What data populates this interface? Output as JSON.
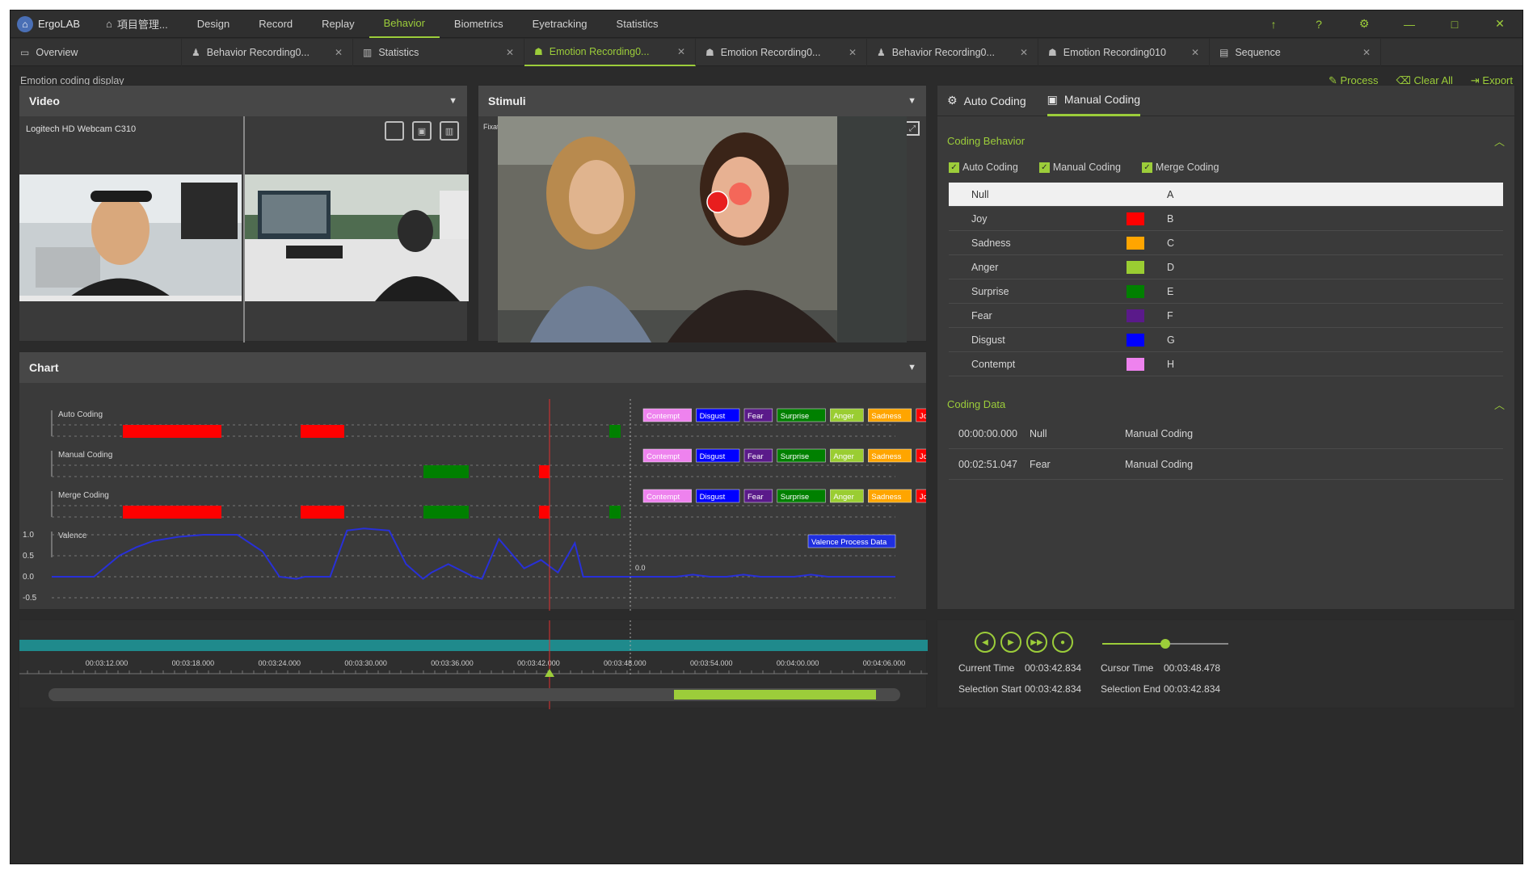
{
  "menubar": {
    "app": "ErgoLAB",
    "items": [
      "項目管理...",
      "Design",
      "Record",
      "Replay",
      "Behavior",
      "Biometrics",
      "Eyetracking",
      "Statistics"
    ],
    "active_index": 4,
    "controls": [
      "↑",
      "?",
      "⚙",
      "—",
      "□",
      "✕"
    ]
  },
  "tabs": [
    {
      "icon": "▭",
      "label": "Overview",
      "closable": false
    },
    {
      "icon": "♟",
      "label": "Behavior Recording0...",
      "closable": true
    },
    {
      "icon": "▥",
      "label": "Statistics",
      "closable": true
    },
    {
      "icon": "☗",
      "label": "Emotion Recording0...",
      "closable": true,
      "active": true
    },
    {
      "icon": "☗",
      "label": "Emotion Recording0...",
      "closable": true
    },
    {
      "icon": "♟",
      "label": "Behavior Recording0...",
      "closable": true
    },
    {
      "icon": "☗",
      "label": "Emotion Recording010",
      "closable": true
    },
    {
      "icon": "▤",
      "label": "Sequence",
      "closable": true
    }
  ],
  "toolbar": {
    "hint": "Emotion coding display",
    "process": "Process",
    "clear_all": "Clear All",
    "export": "Export"
  },
  "video": {
    "title": "Video",
    "source": "Logitech HD Webcam C310"
  },
  "stimuli": {
    "title": "Stimuli",
    "label": "Fixation"
  },
  "coding": {
    "auto_tab": "Auto Coding",
    "manual_tab": "Manual Coding",
    "behavior_title": "Coding Behavior",
    "checks": [
      "Auto Coding",
      "Manual Coding",
      "Merge Coding"
    ],
    "behaviors": [
      {
        "name": "Null",
        "color": "",
        "key": "A"
      },
      {
        "name": "Joy",
        "color": "#ff0000",
        "key": "B"
      },
      {
        "name": "Sadness",
        "color": "#ffa500",
        "key": "C"
      },
      {
        "name": "Anger",
        "color": "#9acd32",
        "key": "D"
      },
      {
        "name": "Surprise",
        "color": "#008000",
        "key": "E"
      },
      {
        "name": "Fear",
        "color": "#5a1a8a",
        "key": "F"
      },
      {
        "name": "Disgust",
        "color": "#0000ff",
        "key": "G"
      },
      {
        "name": "Contempt",
        "color": "#ee82ee",
        "key": "H"
      }
    ],
    "data_title": "Coding Data",
    "data_rows": [
      {
        "time": "00:00:00.000",
        "event": "Null",
        "type": "Manual Coding"
      },
      {
        "time": "00:02:51.047",
        "event": "Fear",
        "type": "Manual Coding"
      }
    ]
  },
  "chart_panel": {
    "title": "Chart",
    "lanes": [
      "Auto Coding",
      "Manual Coding",
      "Merge Coding",
      "Valence"
    ],
    "legend_tags": [
      {
        "label": "Contempt",
        "color": "#ee82ee"
      },
      {
        "label": "Disgust",
        "color": "#0000ff"
      },
      {
        "label": "Fear",
        "color": "#5a1a8a"
      },
      {
        "label": "Surprise",
        "color": "#008000"
      },
      {
        "label": "Anger",
        "color": "#9acd32"
      },
      {
        "label": "Sadness",
        "color": "#ffa500"
      },
      {
        "label": "Joy",
        "color": "#ff0000"
      }
    ],
    "valence_legend": "Valence Process Data",
    "cursor_value": "0.0"
  },
  "chart_data": {
    "type": "line",
    "title": "",
    "series": [
      {
        "name": "Valence",
        "x": [
          0,
          5,
          8,
          10,
          12,
          15,
          18,
          22,
          25,
          27,
          29,
          30,
          33,
          35,
          37,
          40,
          42,
          44,
          45,
          47,
          50,
          51,
          53,
          56,
          58,
          60,
          62,
          63,
          65,
          67,
          70,
          72,
          74,
          76,
          78,
          80,
          82,
          84,
          86,
          88,
          90,
          92,
          95,
          98,
          100
        ],
        "y": [
          0,
          0,
          0.5,
          0.7,
          0.85,
          0.95,
          1.0,
          1.0,
          0.6,
          0.0,
          -0.05,
          0.0,
          0.0,
          1.1,
          1.15,
          1.1,
          0.3,
          -0.05,
          0.1,
          0.3,
          0.0,
          -0.05,
          0.9,
          0.2,
          0.4,
          0.1,
          0.8,
          0.0,
          0.0,
          0.0,
          0.0,
          0.0,
          0.0,
          0.05,
          0.0,
          0.0,
          0.05,
          0.0,
          0.0,
          0.0,
          0.05,
          0.0,
          0.0,
          0.0,
          0.0
        ]
      }
    ],
    "ylim": [
      -0.5,
      1.0
    ],
    "yticks": [
      "1.0",
      "0.5",
      "0.0",
      "-0.5"
    ],
    "grid": true
  },
  "timeline": {
    "ticks": [
      "00:03:12.000",
      "00:03:18.000",
      "00:03:24.000",
      "00:03:30.000",
      "00:03:36.000",
      "00:03:42.000",
      "00:03:48.000",
      "00:03:54.000",
      "00:04:00.000",
      "00:04:06.000"
    ]
  },
  "playback": {
    "buttons": [
      "◀",
      "▶",
      "▶▶",
      "●"
    ],
    "volume": 0.5,
    "current_time_label": "Current Time",
    "current_time": "00:03:42.834",
    "cursor_time_label": "Cursor Time",
    "cursor_time": "00:03:48.478",
    "sel_start_label": "Selection Start",
    "sel_start": "00:03:42.834",
    "sel_end_label": "Selection End",
    "sel_end": "00:03:42.834"
  }
}
